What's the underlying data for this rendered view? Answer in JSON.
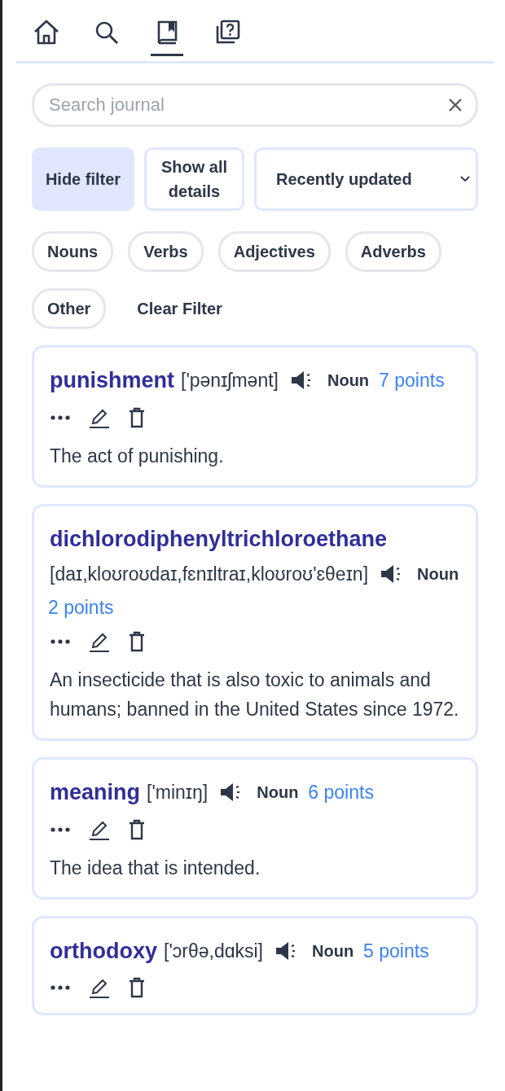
{
  "nav_tabs": [
    {
      "kind": "home",
      "selected": false
    },
    {
      "kind": "search",
      "selected": false
    },
    {
      "kind": "journal",
      "selected": true
    },
    {
      "kind": "quiz",
      "selected": false
    }
  ],
  "search": {
    "placeholder": "Search journal"
  },
  "toolbar": {
    "filter_toggle": {
      "label": "Hide filter",
      "selected": true
    },
    "details_toggle": {
      "label": "Show all details",
      "selected": false
    },
    "sort": {
      "value": "Recently updated"
    }
  },
  "filters": [
    {
      "label": "Nouns"
    },
    {
      "label": "Verbs"
    },
    {
      "label": "Adjectives"
    },
    {
      "label": "Adverbs"
    },
    {
      "label": "Other"
    }
  ],
  "clear_filter": "Clear Filter",
  "entries": [
    {
      "word": "punishment",
      "phonetic": "['pənɪʃmənt]",
      "part_of_speech": "Noun",
      "points": "7 points",
      "definition": "The act of punishing."
    },
    {
      "word": "dichlorodiphenyltrichloroethane",
      "phonetic": "[daɪ,kloʊroʊdaɪ,fɛnɪltraɪ,kloʊroʊ'ɛθeɪn]",
      "part_of_speech": "Noun",
      "points": "2 points",
      "definition": "An insecticide that is also toxic to animals and humans; banned in the United States since 1972."
    },
    {
      "word": "meaning",
      "phonetic": "['minɪŋ]",
      "part_of_speech": "Noun",
      "points": "6 points",
      "definition": "The idea that is intended."
    },
    {
      "word": "orthodoxy",
      "phonetic": "['ɔrθə,dɑksi]",
      "part_of_speech": "Noun",
      "points": "5 points"
    }
  ]
}
